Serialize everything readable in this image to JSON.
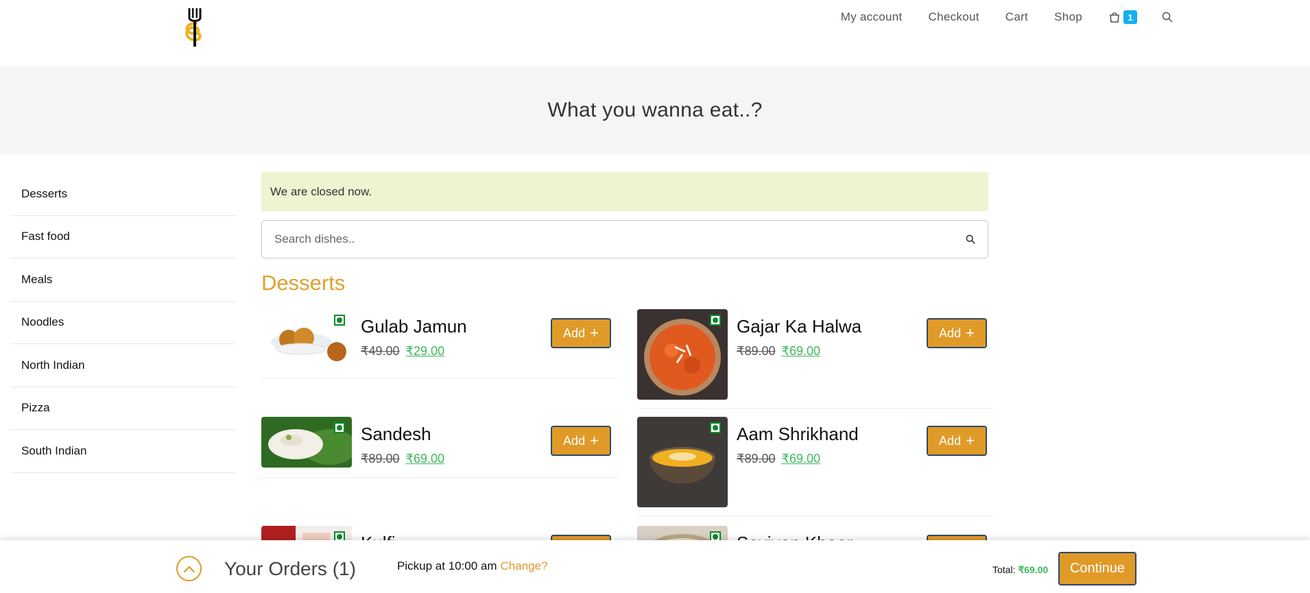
{
  "nav": {
    "items": [
      "My account",
      "Checkout",
      "Cart",
      "Shop"
    ],
    "cart_count": "1"
  },
  "banner": {
    "title": "What you wanna eat..?"
  },
  "sidebar": {
    "items": [
      "Desserts",
      "Fast food",
      "Meals",
      "Noodles",
      "North Indian",
      "Pizza",
      "South Indian"
    ]
  },
  "main": {
    "notice": "We are closed now.",
    "search_placeholder": "Search dishes..",
    "section_title": "Desserts",
    "add_label": "Add",
    "add_icon": "+"
  },
  "dishes": [
    {
      "name": "Gulab Jamun",
      "old_price": "₹49.00",
      "price": "₹29.00"
    },
    {
      "name": "Gajar Ka Halwa",
      "old_price": "₹89.00",
      "price": "₹69.00"
    },
    {
      "name": "Sandesh",
      "old_price": "₹89.00",
      "price": "₹69.00"
    },
    {
      "name": "Aam Shrikhand",
      "old_price": "₹89.00",
      "price": "₹69.00"
    },
    {
      "name": "Kulfi"
    },
    {
      "name": "Seviyan Kheer"
    }
  ],
  "bottom": {
    "orders_label": "Your Orders (1)",
    "pickup_text": "Pickup at 10:00 am",
    "change_label": "Change?",
    "total_label": "Total:",
    "total_amount": "₹69.00",
    "continue_label": "Continue"
  },
  "colors": {
    "accent": "#e09a28",
    "price_green": "#3cb85c",
    "badge_blue": "#13aff0",
    "notice_bg": "#eef4d0",
    "veg_green": "#0a8a2a"
  }
}
